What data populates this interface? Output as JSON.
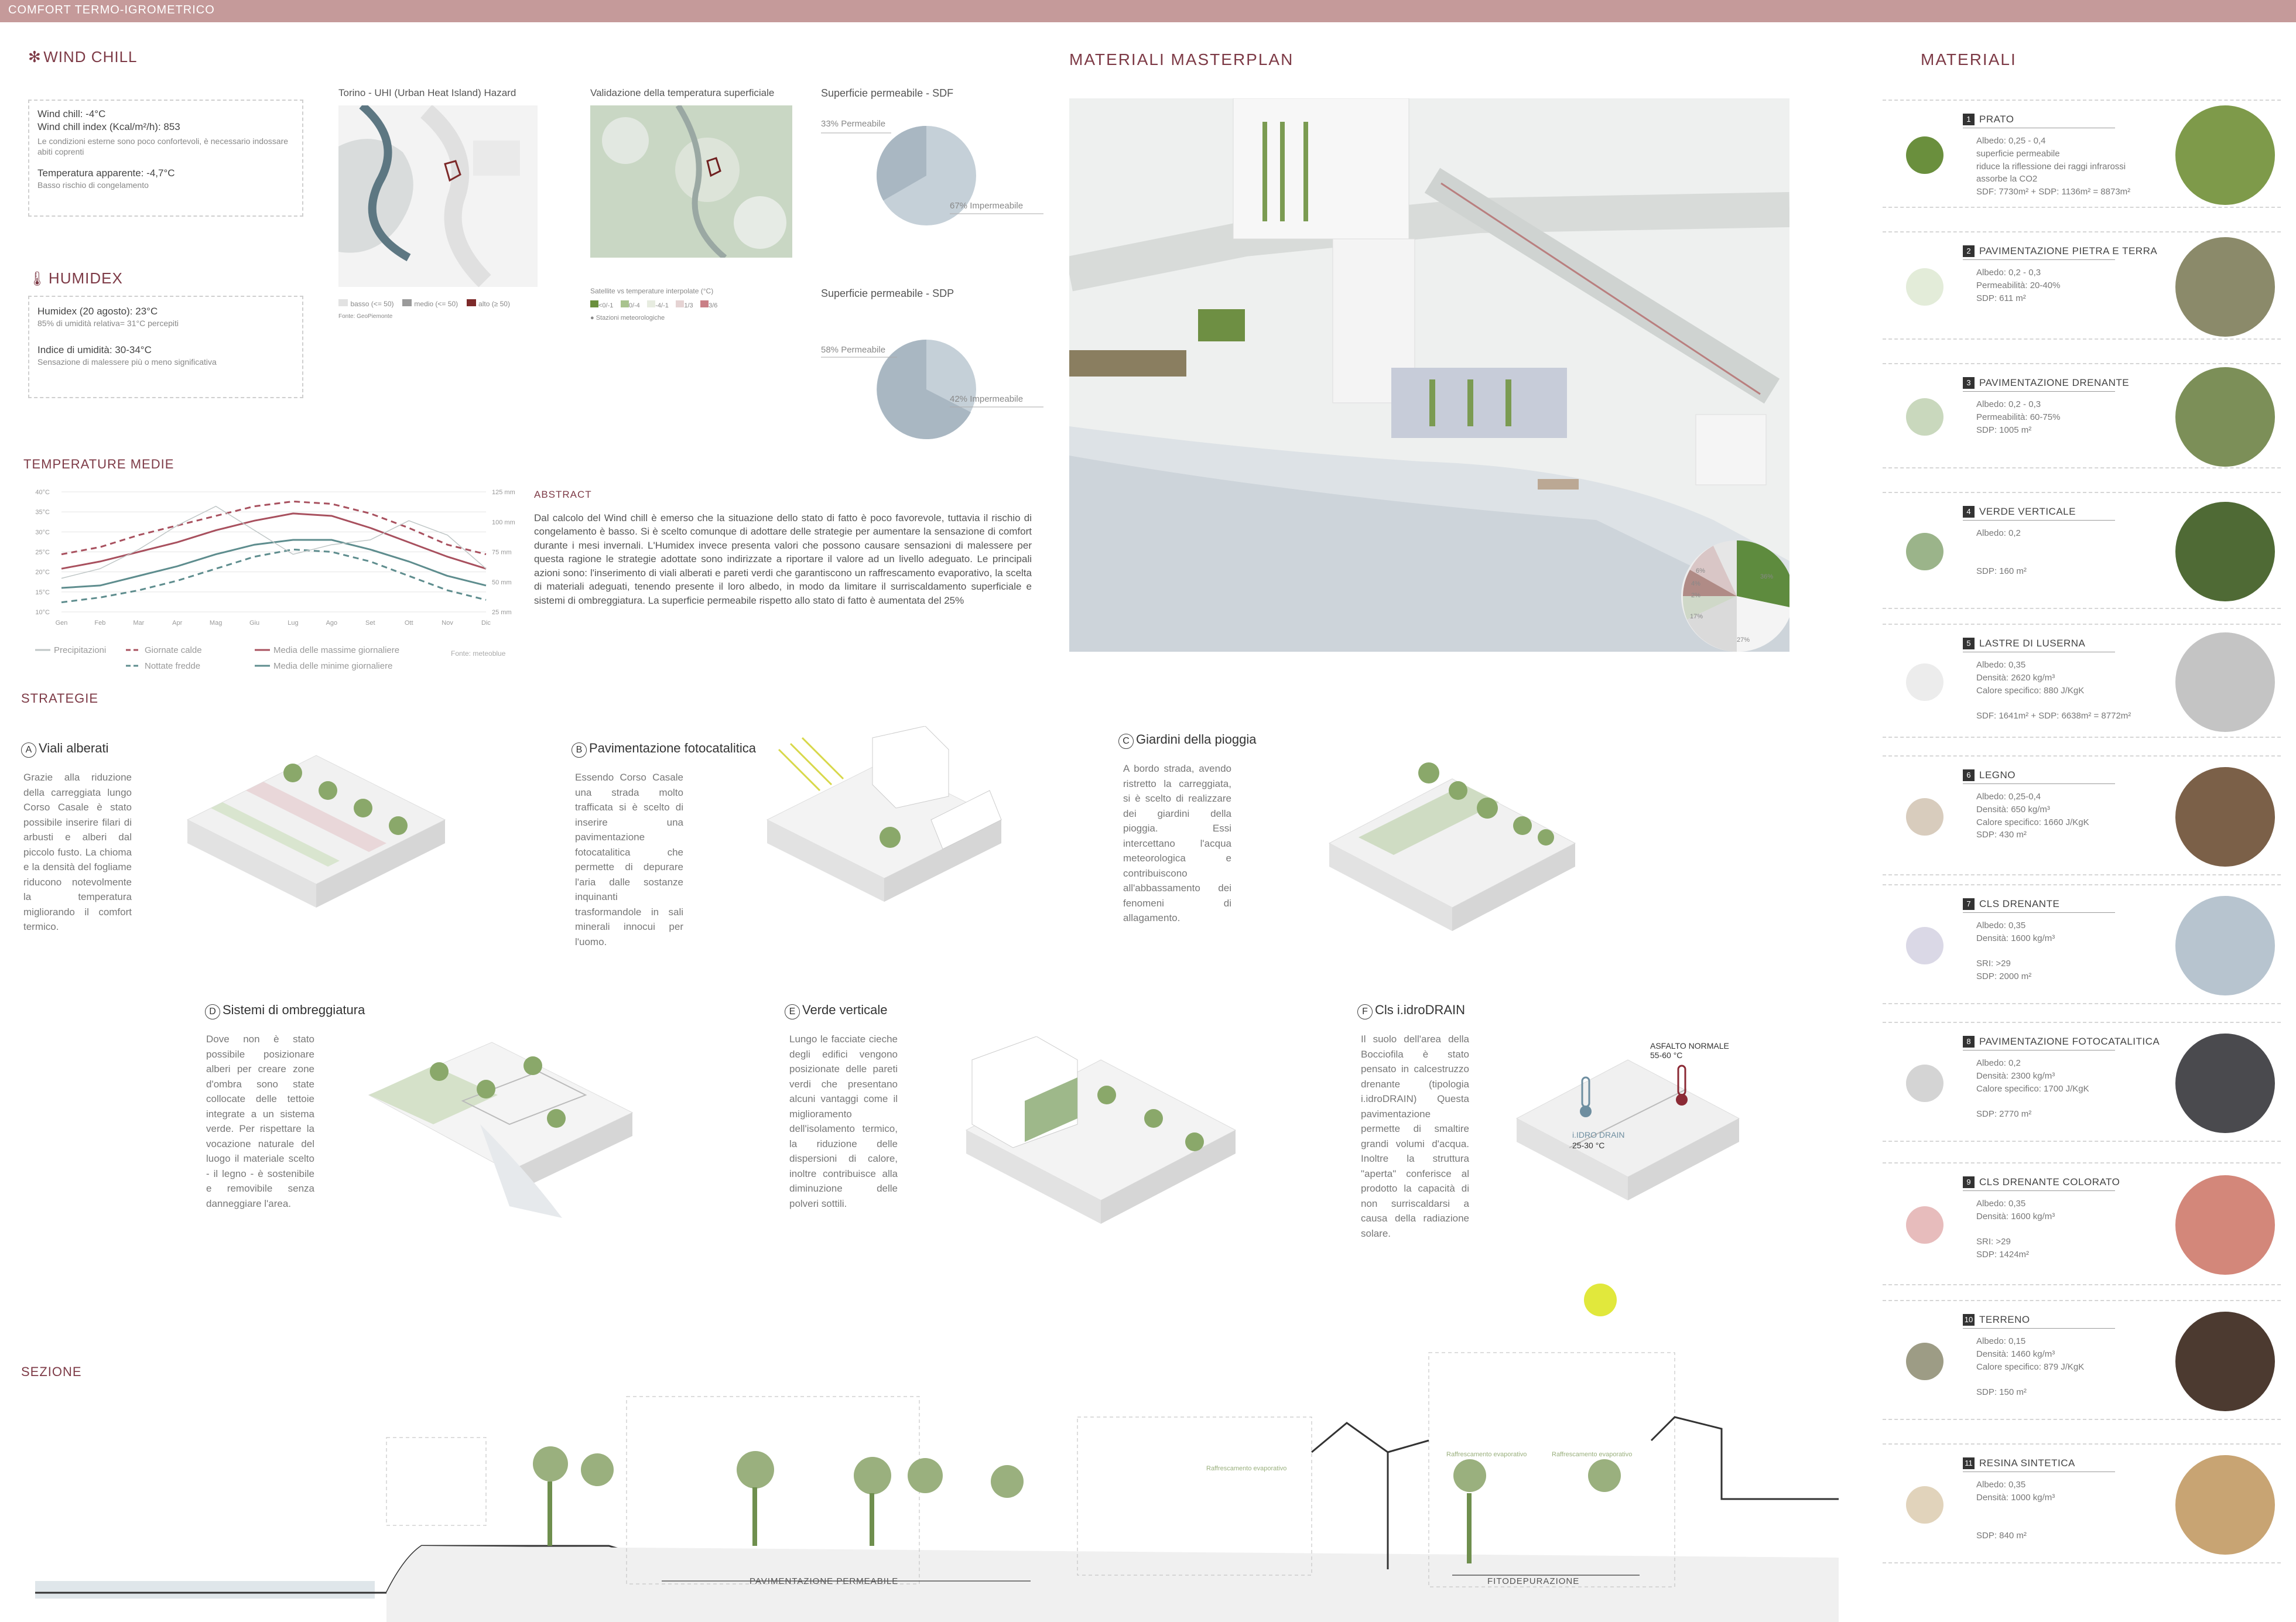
{
  "header": {
    "label": "COMFORT TERMO-IGROMETRICO"
  },
  "wind_chill": {
    "title": "WIND CHILL",
    "line1": "Wind chill: -4°C",
    "line2": "Wind chill index (Kcal/m²/h): 853",
    "line3": "Le condizioni esterne sono poco confortevoli, è necessario indossare abiti coprenti",
    "line4": "Temperatura apparente: -4,7°C",
    "line5": "Basso rischio di congelamento"
  },
  "humidex": {
    "title": "HUMIDEX",
    "line1": "Humidex (20 agosto): 23°C",
    "line2": "85% di umidità relativa= 31°C percepiti",
    "line3": "Indice di umidità: 30-34°C",
    "line4": "Sensazione di malessere più o meno significativa"
  },
  "maps": {
    "uhi_title": "Torino - UHI (Urban Heat Island) Hazard",
    "uhi_legend": [
      "basso (<= 50)",
      "medio (<= 50)",
      "alto (≥ 50)"
    ],
    "valid_title": "Validazione della temperatura superficiale",
    "valid_legend_title": "Satellite vs temperature interpolate (°C)",
    "valid_legend": [
      "<0/-1",
      "0/-4",
      "-4/-1",
      "1/3",
      "3/6"
    ],
    "valid_station": "Stazioni meteorologiche",
    "uhi_source": "Fonte: GeoPiemonte"
  },
  "sdf": {
    "title": "Superficie permeabile - SDF",
    "label_a": "33% Permeabile",
    "label_b": "67% Impermeabile"
  },
  "sdp": {
    "title": "Superficie permeabile - SDP",
    "label_a": "58% Permeabile",
    "label_b": "42% Impermeabile"
  },
  "temps": {
    "title": "TEMPERATURE MEDIE",
    "y_left": [
      "40°C",
      "35°C",
      "30°C",
      "25°C",
      "20°C",
      "15°C",
      "10°C"
    ],
    "y_right": [
      "125 mm",
      "100 mm",
      "75 mm",
      "50 mm",
      "25 mm"
    ],
    "months": [
      "Gen",
      "Feb",
      "Mar",
      "Apr",
      "Mag",
      "Giu",
      "Lug",
      "Ago",
      "Set",
      "Ott",
      "Nov",
      "Dic"
    ],
    "legend": [
      "Precipitazioni",
      "Giornate calde",
      "Nottate fredde",
      "Media delle massime giornaliere",
      "Media delle minime giornaliere"
    ],
    "source": "Fonte: meteoblue"
  },
  "chart_data": {
    "type": "line",
    "categories": [
      "Gen",
      "Feb",
      "Mar",
      "Apr",
      "Mag",
      "Giu",
      "Lug",
      "Ago",
      "Set",
      "Ott",
      "Nov",
      "Dic"
    ],
    "series": [
      {
        "name": "Giornate calde",
        "values": [
          14,
          17,
          22,
          26,
          30,
          34,
          36,
          35,
          31,
          25,
          18,
          14
        ]
      },
      {
        "name": "Media delle massime giornaliere",
        "values": [
          8,
          11,
          15,
          19,
          24,
          28,
          31,
          30,
          25,
          19,
          13,
          8
        ]
      },
      {
        "name": "Media delle minime giornaliere",
        "values": [
          0,
          1,
          5,
          9,
          14,
          18,
          20,
          20,
          16,
          11,
          5,
          1
        ]
      },
      {
        "name": "Nottate fredde",
        "values": [
          -6,
          -4,
          -1,
          3,
          8,
          13,
          16,
          15,
          11,
          5,
          -1,
          -5
        ]
      },
      {
        "name": "Precipitazioni",
        "values": [
          35,
          45,
          65,
          90,
          110,
          85,
          60,
          70,
          75,
          95,
          80,
          45
        ]
      }
    ],
    "ylim": [
      -10,
      40
    ]
  },
  "abstract": {
    "title": "ABSTRACT",
    "body": "Dal calcolo del Wind chill è emerso che la situazione dello stato di fatto è poco favorevole, tuttavia il rischio di congelamento è basso. Si è scelto comunque di adottare delle strategie per aumentare la sensazione di comfort durante i mesi invernali. L'Humidex invece presenta valori che possono causare sensazioni di malessere per questa ragione le strategie adottate sono indirizzate a riportare il valore ad un livello adeguato. Le principali azioni sono: l'inserimento di viali alberati e pareti verdi che garantiscono un raffrescamento evaporativo, la scelta di materiali adeguati, tenendo presente il loro albedo, in modo da limitare il surriscaldamento superficiale e sistemi di ombreggiatura. La superficie permeabile rispetto allo stato di fatto è aumentata del 25%"
  },
  "masterplan": {
    "title": "MATERIALI MASTERPLAN",
    "pie_labels": [
      "36%",
      "27%",
      "17%",
      "6%",
      "4%",
      "2%"
    ]
  },
  "strategie": {
    "title": "STRATEGIE",
    "items": [
      {
        "letter": "A",
        "title": "Viali alberati",
        "text": "Grazie alla riduzione della carreggiata lungo Corso Casale è stato possibile inserire filari di arbusti e alberi dal piccolo fusto. La chioma e la densità del fogliame riducono notevolmente la temperatura migliorando il comfort termico."
      },
      {
        "letter": "B",
        "title": "Pavimentazione fotocatalitica",
        "text": "Essendo Corso Casale una strada molto trafficata si è scelto di inserire una pavimentazione fotocatalitica che permette di depurare l'aria dalle sostanze inquinanti trasformandole in sali minerali innocui per l'uomo."
      },
      {
        "letter": "C",
        "title": "Giardini della pioggia",
        "text": "A bordo strada, avendo ristretto la carreggiata, si è scelto di realizzare dei giardini della pioggia. Essi intercettano l'acqua meteorologica e contribuiscono all'abbassamento dei fenomeni di allagamento."
      },
      {
        "letter": "D",
        "title": "Sistemi di ombreggiatura",
        "text": "Dove non è stato possibile posizionare alberi per creare zone d'ombra sono state collocate delle tettoie integrate a un sistema verde. Per rispettare la vocazione naturale del luogo il materiale scelto - il legno - è sostenibile e removibile senza danneggiare l'area."
      },
      {
        "letter": "E",
        "title": "Verde verticale",
        "text": "Lungo le facciate cieche degli edifici vengono posizionate delle pareti verdi che presentano alcuni vantaggi come il miglioramento dell'isolamento termico, la riduzione delle dispersioni di calore, inoltre contribuisce alla diminuzione delle polveri sottili."
      },
      {
        "letter": "F",
        "title": "Cls i.idroDRAIN",
        "text": "Il suolo dell'area della Bocciofila è stato pensato in calcestruzzo drenante (tipologia i.idroDRAIN) Questa pavimentazione permette di smaltire grandi volumi d'acqua. Inoltre la struttura \"aperta\" conferisce al prodotto la capacità di non surriscaldarsi a causa della radiazione solare."
      }
    ],
    "asphalt_label": "ASFALTO NORMALE",
    "asphalt_temp": "55-60 °C",
    "idrodrain_label": "i.IDRO DRAIN",
    "idrodrain_temp": "25-30 °C"
  },
  "sezione": {
    "title": "SEZIONE",
    "label_left": "PAVIMENTAZIONE PERMEABILE",
    "label_right": "FITODEPURAZIONE",
    "evap1": "Raffrescamento evaporativo",
    "evap2": "Raffrescamento evaporativo",
    "evap3": "Raffrescamento evaporativo"
  },
  "materiali": {
    "title": "MATERIALI",
    "items": [
      {
        "num": "1",
        "name": "PRATO",
        "props": "Albedo: 0,25 - 0,4\nsuperficie permeabile\nriduce la riflessione dei raggi infrarossi\nassorbe la CO2\nSDF: 7730m² + SDP: 1136m² = 8873m²",
        "dot": "#6a8f3d",
        "swatch": "#7e9a4a"
      },
      {
        "num": "2",
        "name": "PAVIMENTAZIONE PIETRA E TERRA",
        "props": "Albedo: 0,2 - 0,3\nPermeabilità: 20-40%\nSDP: 611 m²",
        "dot": "#e3ecd9",
        "swatch": "#8b8a6a"
      },
      {
        "num": "3",
        "name": "PAVIMENTAZIONE DRENANTE",
        "props": "Albedo: 0,2 - 0,3\nPermeabilità: 60-75%\nSDP: 1005 m²",
        "dot": "#c9d8bd",
        "swatch": "#7c8f58"
      },
      {
        "num": "4",
        "name": "VERDE VERTICALE",
        "props": "Albedo: 0,2\n\n\nSDP: 160 m²",
        "dot": "#9bb48a",
        "swatch": "#4f6a35"
      },
      {
        "num": "5",
        "name": "LASTRE DI LUSERNA",
        "props": "Albedo: 0,35\nDensità: 2620 kg/m³\nCalore specifico: 880 J/KgK\n\nSDF: 1641m² + SDP: 6638m² = 8772m²",
        "dot": "#ececec",
        "swatch": "#c4c4c4"
      },
      {
        "num": "6",
        "name": "LEGNO",
        "props": "Albedo: 0,25-0,4\nDensità: 650 kg/m³\nCalore specifico: 1660 J/KgK\nSDP: 430 m²",
        "dot": "#d8ccbd",
        "swatch": "#7b6048"
      },
      {
        "num": "7",
        "name": "CLS DRENANTE",
        "props": "Albedo: 0,35\nDensità: 1600 kg/m³\n\nSRI: >29\nSDP: 2000 m²",
        "dot": "#dad8e6",
        "swatch": "#b7c4cf"
      },
      {
        "num": "8",
        "name": "PAVIMENTAZIONE FOTOCATALITICA",
        "props": "Albedo: 0,2\nDensità: 2300 kg/m³\nCalore specifico: 1700 J/KgK\n\nSDP: 2770 m²",
        "dot": "#d4d4d4",
        "swatch": "#4a4a4e"
      },
      {
        "num": "9",
        "name": "CLS DRENANTE COLORATO",
        "props": "Albedo: 0,35\nDensità: 1600 kg/m³\n\nSRI: >29\nSDP: 1424m²",
        "dot": "#e7bcbc",
        "swatch": "#d3877a"
      },
      {
        "num": "10",
        "name": "TERRENO",
        "props": "Albedo: 0,15\nDensità: 1460 kg/m³\nCalore specifico: 879 J/KgK\n\nSDP: 150 m²",
        "dot": "#9d9c85",
        "swatch": "#4c3a30"
      },
      {
        "num": "11",
        "name": "RESINA SINTETICA",
        "props": "Albedo: 0,35\nDensità: 1000 kg/m³\n\n\nSDP: 840 m²",
        "dot": "#e1d3bb",
        "swatch": "#c8a473"
      }
    ]
  }
}
